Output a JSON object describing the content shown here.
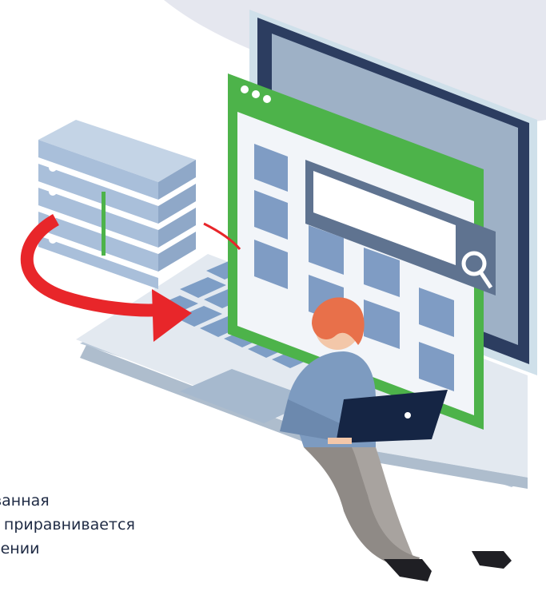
{
  "illustration": {
    "colors": {
      "background_blob": "#e5e7ef",
      "laptop_frame": "#cfd9e3",
      "laptop_screen": "#2c3d60",
      "keyboard_key": "#7e9ec6",
      "browser_frame": "#4db34a",
      "folder": "#7f9cc4",
      "arrow": "#e8262a",
      "books": "#a9bfda",
      "person_hair": "#e8704a",
      "person_shirt": "#7d9bc0",
      "person_pants": "#a8a39f",
      "small_laptop": "#152544"
    },
    "icons": [
      "server-books-icon",
      "browser-window-icon",
      "folder-icon",
      "search-magnifier-icon",
      "circular-arrow-icon",
      "person-with-laptop-icon"
    ]
  },
  "caption": {
    "lines": [
      "цированная",
      "- приравнивается",
      "остижении"
    ]
  }
}
